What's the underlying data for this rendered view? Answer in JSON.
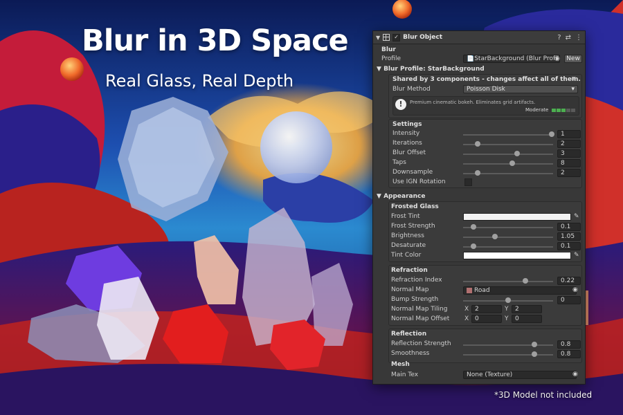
{
  "hero": {
    "title": "Blur in 3D Space",
    "subtitle": "Real Glass, Real Depth",
    "footnote": "*3D Model not included"
  },
  "inspector": {
    "component_title": "Blur Object",
    "header_icons": [
      "help-icon",
      "settings-icon",
      "menu-dots-icon"
    ],
    "blur_section": "Blur",
    "profile_label": "Profile",
    "profile_value": "StarBackground (Blur Profile)",
    "new_button": "New",
    "profile_header": "Blur Profile: StarBackground",
    "shared_note": "Shared by 3 components - changes affect all of them.",
    "blur_method_label": "Blur Method",
    "blur_method_value": "Poisson Disk",
    "info_text": "Premium cinematic bokeh. Eliminates grid artifacts.",
    "quality_label": "Moderate",
    "quality_level": 3,
    "quality_max": 5,
    "settings_header": "Settings",
    "settings": [
      {
        "label": "Intensity",
        "value": "1",
        "fraction": 1.0
      },
      {
        "label": "Iterations",
        "value": "2",
        "fraction": 0.15
      },
      {
        "label": "Blur Offset",
        "value": "3",
        "fraction": 0.6
      },
      {
        "label": "Taps",
        "value": "8",
        "fraction": 0.55
      },
      {
        "label": "Downsample",
        "value": "2",
        "fraction": 0.15
      }
    ],
    "ign_label": "Use IGN Rotation",
    "appearance_header": "Appearance",
    "frosted_header": "Frosted Glass",
    "frost_tint_label": "Frost Tint",
    "frost_tint_color": "#f2f2f2",
    "frost_rows": [
      {
        "label": "Frost Strength",
        "value": "0.1",
        "fraction": 0.1
      },
      {
        "label": "Brightness",
        "value": "1.05",
        "fraction": 0.35
      },
      {
        "label": "Desaturate",
        "value": "0.1",
        "fraction": 0.1
      }
    ],
    "tint_color_label": "Tint Color",
    "tint_color": "#ffffff",
    "refraction_header": "Refraction",
    "refraction_index_label": "Refraction Index",
    "refraction_index_value": "0.22",
    "refraction_index_fraction": 0.7,
    "normal_map_label": "Normal Map",
    "normal_map_value": "Road",
    "bump_strength_label": "Bump Strength",
    "bump_strength_value": "0",
    "bump_strength_fraction": 0.5,
    "tiling_label": "Normal Map Tiling",
    "tiling_x": "2",
    "tiling_y": "2",
    "offset_label": "Normal Map Offset",
    "offset_x": "0",
    "offset_y": "0",
    "x_label": "X",
    "y_label": "Y",
    "reflection_header": "Reflection",
    "reflection_strength_label": "Reflection Strength",
    "reflection_strength_value": "0.8",
    "reflection_strength_fraction": 0.8,
    "smoothness_label": "Smoothness",
    "smoothness_value": "0.8",
    "smoothness_fraction": 0.8,
    "mesh_header": "Mesh",
    "main_tex_label": "Main Tex",
    "main_tex_value": "None (Texture)"
  },
  "colors": {
    "accent_green": "#4caf50",
    "panel_bg": "#383838"
  }
}
